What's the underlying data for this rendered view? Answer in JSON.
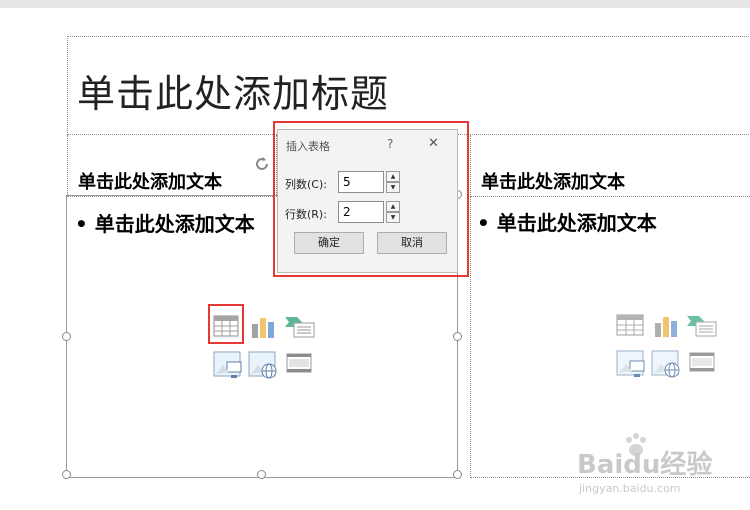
{
  "slide": {
    "title_placeholder": "单击此处添加标题",
    "left": {
      "heading": "单击此处添加文本",
      "bullet": "单击此处添加文本"
    },
    "right": {
      "heading": "单击此处添加文本",
      "bullet": "单击此处添加文本"
    }
  },
  "dialog": {
    "title": "插入表格",
    "help": "?",
    "close": "✕",
    "columns_label": "列数(C):",
    "columns_value": "5",
    "rows_label": "行数(R):",
    "rows_value": "2",
    "ok": "确定",
    "cancel": "取消"
  },
  "watermark": {
    "logo": "Baidu经验",
    "url": "jingyan.baidu.com"
  }
}
